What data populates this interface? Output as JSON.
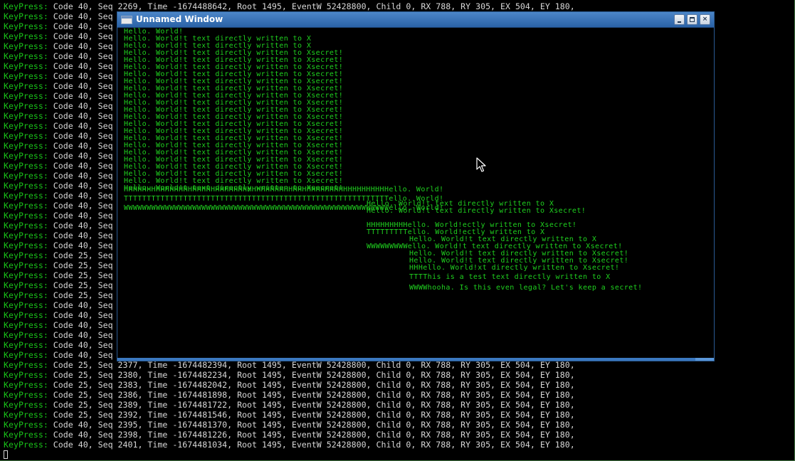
{
  "terminal": {
    "lines": [
      {
        "label": "KeyPress:",
        "rest": " Code 40, Seq 2269, Time -1674488642, Root 1495, EventW 52428800, Child 0, RX 788, RY 305, EX 504, EY 180,"
      },
      {
        "label": "KeyPress:",
        "rest": " Code 40, Seq"
      },
      {
        "label": "KeyPress:",
        "rest": " Code 40, Seq"
      },
      {
        "label": "KeyPress:",
        "rest": " Code 40, Seq"
      },
      {
        "label": "KeyPress:",
        "rest": " Code 40, Seq"
      },
      {
        "label": "KeyPress:",
        "rest": " Code 40, Seq"
      },
      {
        "label": "KeyPress:",
        "rest": " Code 40, Seq"
      },
      {
        "label": "KeyPress:",
        "rest": " Code 40, Seq"
      },
      {
        "label": "KeyPress:",
        "rest": " Code 40, Seq"
      },
      {
        "label": "KeyPress:",
        "rest": " Code 40, Seq"
      },
      {
        "label": "KeyPress:",
        "rest": " Code 40, Seq"
      },
      {
        "label": "KeyPress:",
        "rest": " Code 40, Seq"
      },
      {
        "label": "KeyPress:",
        "rest": " Code 40, Seq"
      },
      {
        "label": "KeyPress:",
        "rest": " Code 40, Seq"
      },
      {
        "label": "KeyPress:",
        "rest": " Code 40, Seq"
      },
      {
        "label": "KeyPress:",
        "rest": " Code 40, Seq"
      },
      {
        "label": "KeyPress:",
        "rest": " Code 40, Seq"
      },
      {
        "label": "KeyPress:",
        "rest": " Code 40, Seq"
      },
      {
        "label": "KeyPress:",
        "rest": " Code 40, Seq"
      },
      {
        "label": "KeyPress:",
        "rest": " Code 40, Seq"
      },
      {
        "label": "KeyPress:",
        "rest": " Code 40, Seq"
      },
      {
        "label": "KeyPress:",
        "rest": " Code 40, Seq"
      },
      {
        "label": "KeyPress:",
        "rest": " Code 40, Seq"
      },
      {
        "label": "KeyPress:",
        "rest": " Code 40, Seq"
      },
      {
        "label": "KeyPress:",
        "rest": " Code 40, Seq"
      },
      {
        "label": "KeyPress:",
        "rest": " Code 25, Seq"
      },
      {
        "label": "KeyPress:",
        "rest": " Code 25, Seq"
      },
      {
        "label": "KeyPress:",
        "rest": " Code 25, Seq"
      },
      {
        "label": "KeyPress:",
        "rest": " Code 25, Seq"
      },
      {
        "label": "KeyPress:",
        "rest": " Code 25, Seq"
      },
      {
        "label": "KeyPress:",
        "rest": " Code 40, Seq"
      },
      {
        "label": "KeyPress:",
        "rest": " Code 40, Seq"
      },
      {
        "label": "KeyPress:",
        "rest": " Code 40, Seq"
      },
      {
        "label": "KeyPress:",
        "rest": " Code 40, Seq"
      },
      {
        "label": "KeyPress:",
        "rest": " Code 40, Seq"
      },
      {
        "label": "KeyPress:",
        "rest": " Code 40, Seq"
      },
      {
        "label": "KeyPress:",
        "rest": " Code 25, Seq 2377, Time -1674482394, Root 1495, EventW 52428800, Child 0, RX 788, RY 305, EX 504, EY 180,"
      },
      {
        "label": "KeyPress:",
        "rest": " Code 25, Seq 2380, Time -1674482234, Root 1495, EventW 52428800, Child 0, RX 788, RY 305, EX 504, EY 180,"
      },
      {
        "label": "KeyPress:",
        "rest": " Code 25, Seq 2383, Time -1674482042, Root 1495, EventW 52428800, Child 0, RX 788, RY 305, EX 504, EY 180,"
      },
      {
        "label": "KeyPress:",
        "rest": " Code 25, Seq 2386, Time -1674481898, Root 1495, EventW 52428800, Child 0, RX 788, RY 305, EX 504, EY 180,"
      },
      {
        "label": "KeyPress:",
        "rest": " Code 25, Seq 2389, Time -1674481722, Root 1495, EventW 52428800, Child 0, RX 788, RY 305, EX 504, EY 180,"
      },
      {
        "label": "KeyPress:",
        "rest": " Code 25, Seq 2392, Time -1674481546, Root 1495, EventW 52428800, Child 0, RX 788, RY 305, EX 504, EY 180,"
      },
      {
        "label": "KeyPress:",
        "rest": " Code 40, Seq 2395, Time -1674481370, Root 1495, EventW 52428800, Child 0, RX 788, RY 305, EX 504, EY 180,"
      },
      {
        "label": "KeyPress:",
        "rest": " Code 40, Seq 2398, Time -1674481226, Root 1495, EventW 52428800, Child 0, RX 788, RY 305, EX 504, EY 180,"
      },
      {
        "label": "KeyPress:",
        "rest": " Code 40, Seq 2401, Time -1674481034, Root 1495, EventW 52428800, Child 0, RX 788, RY 305, EX 504, EY 180,"
      }
    ]
  },
  "window": {
    "title": "Unnamed Window",
    "minimize_icon": "minimize-icon",
    "maximize_icon": "maximize-icon",
    "close_glyph": "×"
  },
  "canvas": {
    "lines": [
      {
        "text": "Hello. World!"
      },
      {
        "text": "Hello. World!t text directly written to X"
      },
      {
        "text": "Hello. World!t text directly written to X"
      },
      {
        "text": "Hello. World!t text directly written to Xsecret!"
      },
      {
        "text": "Hello. World!t text directly written to Xsecret!"
      },
      {
        "text": "Hello. World!t text directly written to Xsecret!"
      },
      {
        "text": "Hello. World!t text directly written to Xsecret!"
      },
      {
        "text": "Hello. World!t text directly written to Xsecret!"
      },
      {
        "text": "Hello. World!t text directly written to Xsecret!"
      },
      {
        "text": "Hello. World!t text directly written to Xsecret!"
      },
      {
        "text": "Hello. World!t text directly written to Xsecret!"
      },
      {
        "text": "Hello. World!t text directly written to Xsecret!"
      },
      {
        "text": "Hello. World!t text directly written to Xsecret!"
      },
      {
        "text": "Hello. World!t text directly written to Xsecret!"
      },
      {
        "text": "Hello. World!t text directly written to Xsecret!"
      },
      {
        "text": "Hello. World!t text directly written to Xsecret!"
      },
      {
        "text": "Hello. World!t text directly written to Xsecret!"
      },
      {
        "text": "Hello. World!t text directly written to Xsecret!"
      },
      {
        "text": "Hello. World!t text directly written to Xsecret!"
      },
      {
        "text": "Hello. World!t text directly written to Xsecret!"
      },
      {
        "text": "Hello. World!t text directly written to Xsecret!"
      },
      {
        "text": "Hello. World!t text directly written to Xsecret!"
      },
      {
        "text": "Hello. World!t text directly written to Xsecret!"
      },
      {
        "text": "HHHHHHHHHHHHHHHHHHHHHHHHHHHHHHHHHHHHHHHHHHHHHHHHHHHHHHHHHHello. World!"
      },
      {
        "text": "TTTTTTTTTTTTTTTTTTTTTTTTTTTTTTTTTTTTTTTTTTTTTTTTTTTTTTTTTTello. World!"
      },
      {
        "text": "WWWWWWWWWWWWWWWWWWWWWWWWWWWWWWWWWWWWWWWWWWWWWWWWWWWWWWWWWWello. World!"
      },
      {
        "text": "Hello. World!t text directly written to X"
      },
      {
        "text": "Hello. World!t text directly written to Xsecret!"
      },
      {
        "text": "HHHHHHHHHello. World!ectly written to Xsecret!"
      },
      {
        "text": "TTTTTTTTTello. World!ectly written to X"
      },
      {
        "text": "Hello. World!t text directly written to X"
      },
      {
        "text": "WWWWWWWWWello. World!t text directly written to Xsecret!"
      },
      {
        "text": "Hello. World!t text directly written to Xsecret!"
      },
      {
        "text": "Hello. World!t text directly written to Xsecret!"
      },
      {
        "text": "HHHello. World!xt directly written to Xsecret!"
      },
      {
        "text": "TTTThis is a test text directly written to X"
      },
      {
        "text": "WWWWhooha. Is this even legal? Let's keep a secret!"
      }
    ]
  },
  "colors": {
    "label_green": "#19c219",
    "terminal_text": "#d8d8d8",
    "canvas_green": "#1fd11f",
    "titlebar_blue": "#3a72b6"
  }
}
